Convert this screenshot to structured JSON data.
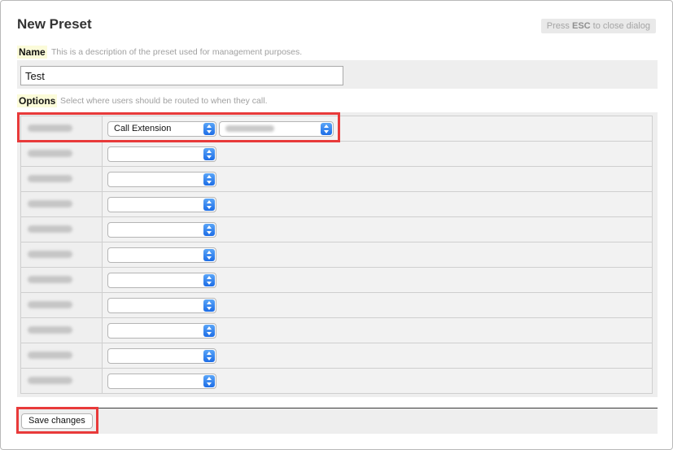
{
  "dialog": {
    "title": "New Preset",
    "esc_hint_prefix": "Press ",
    "esc_hint_key": "ESC",
    "esc_hint_suffix": " to close dialog"
  },
  "name_section": {
    "label": "Name",
    "description": "This is a description of the preset used for management purposes.",
    "value": "Test"
  },
  "options_section": {
    "label": "Options",
    "description": "Select where users should be routed to when they call.",
    "rows": [
      {
        "selected": "Call Extension",
        "has_target": true
      },
      {
        "selected": ""
      },
      {
        "selected": ""
      },
      {
        "selected": ""
      },
      {
        "selected": ""
      },
      {
        "selected": ""
      },
      {
        "selected": ""
      },
      {
        "selected": ""
      },
      {
        "selected": ""
      },
      {
        "selected": ""
      },
      {
        "selected": ""
      }
    ]
  },
  "footer": {
    "save_label": "Save changes"
  },
  "colors": {
    "highlight": "#e83a3a",
    "select_arrow": "#1d6de6"
  }
}
